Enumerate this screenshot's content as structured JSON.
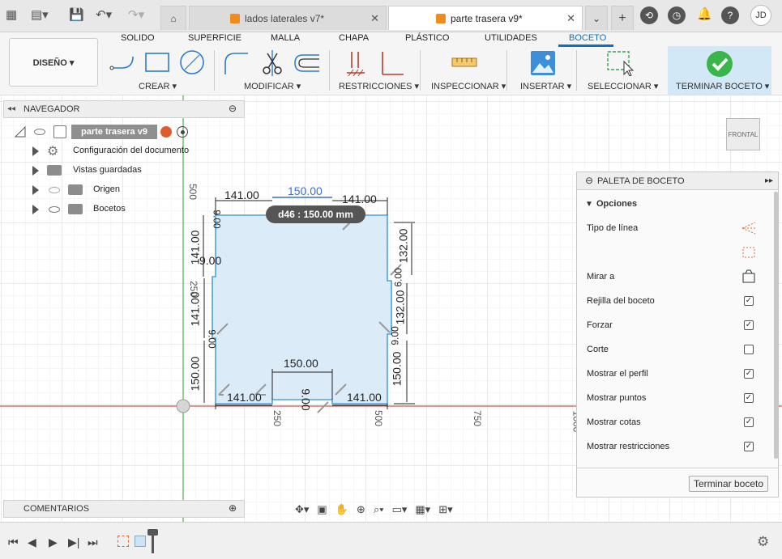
{
  "titlebar": {
    "tabs": [
      {
        "title": "lados laterales v7*",
        "active": false
      },
      {
        "title": "parte trasera v9*",
        "active": true
      }
    ],
    "user_initials": "JD"
  },
  "toolbar": {
    "workspace": "DISEÑO ▾",
    "tabs": [
      "SOLIDO",
      "SUPERFICIE",
      "MALLA",
      "CHAPA",
      "PLÁSTICO",
      "UTILIDADES",
      "BOCETO"
    ],
    "active_tab": "BOCETO",
    "groups": {
      "crear": "CREAR ▾",
      "modificar": "MODIFICAR ▾",
      "restricciones": "RESTRICCIONES ▾",
      "inspeccionar": "INSPECCIONAR ▾",
      "insertar": "INSERTAR ▾",
      "seleccionar": "SELECCIONAR ▾",
      "terminar": "TERMINAR BOCETO ▾"
    }
  },
  "navigator": {
    "title": "NAVEGADOR",
    "root": "parte trasera v9",
    "items": [
      "Configuración del documento",
      "Vistas guardadas",
      "Origen",
      "Bocetos"
    ]
  },
  "viewcube": {
    "label": "FRONTAL"
  },
  "palette": {
    "title": "PALETA DE BOCETO",
    "section": "Opciones",
    "rows": [
      {
        "label": "Tipo de línea",
        "kind": "icon"
      },
      {
        "label": "",
        "kind": "icon"
      },
      {
        "label": "Mirar a",
        "kind": "icon"
      },
      {
        "label": "Rejilla del boceto",
        "kind": "check",
        "checked": true
      },
      {
        "label": "Forzar",
        "kind": "check",
        "checked": true
      },
      {
        "label": "Corte",
        "kind": "check",
        "checked": false
      },
      {
        "label": "Mostrar el perfil",
        "kind": "check",
        "checked": true
      },
      {
        "label": "Mostrar puntos",
        "kind": "check",
        "checked": true
      },
      {
        "label": "Mostrar cotas",
        "kind": "check",
        "checked": true
      },
      {
        "label": "Mostrar restricciones",
        "kind": "check",
        "checked": true
      }
    ],
    "finish_button": "Terminar boceto"
  },
  "comments": {
    "title": "COMENTARIOS"
  },
  "sketch": {
    "tooltip": "d46 : 150.00 mm",
    "dims": {
      "top_left": "141.00",
      "top_mid": "150.00",
      "top_right": "141.00",
      "left_upper": "141.00",
      "notch_left": "9.00",
      "left_mid": "141.00",
      "left_lower": "150.00",
      "right_upper": "132.00",
      "right_mid": "132.00",
      "right_lower": "150.00",
      "bottom_mid": "150.00",
      "bottom_left": "141.00",
      "bottom_right": "141.00",
      "bottom_notch": "9.00",
      "small_a": "9.00",
      "small_b": "9.00",
      "small_c": "6.00",
      "small_d": "9.00"
    },
    "axis_labels": {
      "v500": "500",
      "v250": "250",
      "h250": "250",
      "h500": "500",
      "h750": "750",
      "h1000": "1000"
    }
  },
  "colors": {
    "accent": "#0a72c6",
    "sketch_line": "#4aa3df",
    "profile_fill": "#dcebf8",
    "x_axis": "#d9534f",
    "y_axis": "#6cc46c",
    "finish_green": "#39b54a"
  }
}
